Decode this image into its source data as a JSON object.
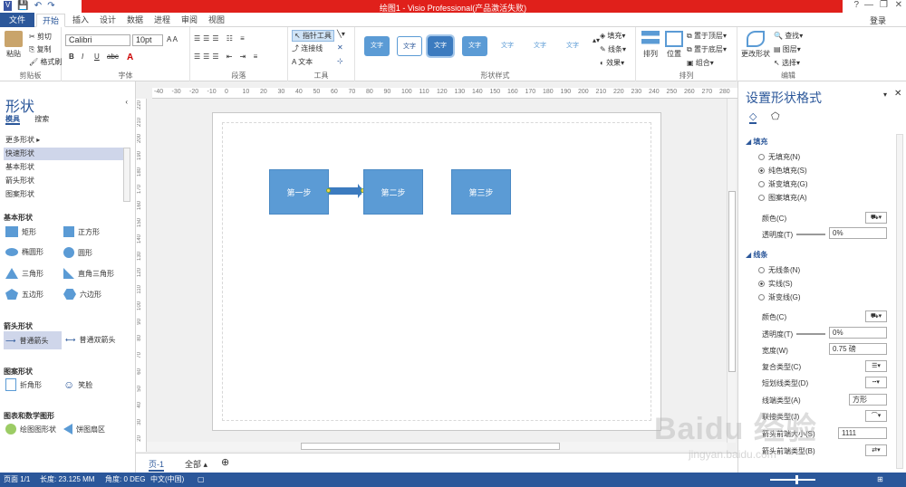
{
  "titlebar": {
    "title": "绘图1 - Visio Professional(产品激活失败)"
  },
  "menu": {
    "file": "文件",
    "tabs": [
      "开始",
      "插入",
      "设计",
      "数据",
      "进程",
      "审阅",
      "视图"
    ],
    "login": "登录"
  },
  "ribbon": {
    "clipboard": {
      "paste": "粘贴",
      "cut": "剪切",
      "copy": "复制",
      "format_painter": "格式刷",
      "label": "剪贴板"
    },
    "font": {
      "name": "Calibri",
      "size": "10pt",
      "bold": "B",
      "italic": "I",
      "underline": "U",
      "strike": "abc",
      "fontcolor": "A",
      "label": "字体"
    },
    "paragraph": {
      "label": "段落"
    },
    "tools": {
      "pointer": "指针工具",
      "connector": "连接线",
      "text": "文本",
      "label": "工具"
    },
    "shape_styles": {
      "previews": [
        "文字",
        "文字",
        "文字",
        "文字",
        "文字",
        "文字",
        "文字"
      ],
      "label": "形状样式",
      "fill": "填充",
      "line": "线条",
      "effects": "效果"
    },
    "arrange": {
      "align": "排列",
      "position": "位置",
      "bring_front": "置于顶层",
      "send_back": "置于底层",
      "group": "组合",
      "label": "排列"
    },
    "editing": {
      "change_shape": "更改形状",
      "find": "查找",
      "layers": "图层",
      "select": "选择",
      "label": "编辑"
    }
  },
  "shapes_panel": {
    "title": "形状",
    "tabs": [
      "模具",
      "搜索"
    ],
    "more": "更多形状",
    "stencils": [
      "快速形状",
      "基本形状",
      "箭头形状",
      "图案形状"
    ],
    "basic_title": "基本形状",
    "basic": [
      "矩形",
      "正方形",
      "椭圆形",
      "圆形",
      "三角形",
      "直角三角形",
      "五边形",
      "六边形"
    ],
    "arrow_title": "箭头形状",
    "arrows": [
      "普通箭头",
      "普通双箭头"
    ],
    "pattern_title": "图案形状",
    "patterns": [
      "折角形",
      "笑脸"
    ],
    "chart_title": "图表和数学图形",
    "charts": [
      "绘图图形状",
      "饼图扇区"
    ]
  },
  "ruler": {
    "h": [
      "-40",
      "-30",
      "-20",
      "-10",
      "0",
      "10",
      "20",
      "30",
      "40",
      "50",
      "60",
      "70",
      "80",
      "90",
      "100",
      "110",
      "120",
      "130",
      "140",
      "150",
      "160",
      "170",
      "180",
      "190",
      "200",
      "210",
      "220",
      "230",
      "240",
      "250",
      "260",
      "270",
      "280"
    ],
    "v": [
      "220",
      "210",
      "200",
      "190",
      "180",
      "170",
      "160",
      "150",
      "140",
      "130",
      "120",
      "110",
      "100",
      "90",
      "80",
      "70",
      "60",
      "50",
      "40",
      "30",
      "20"
    ]
  },
  "diagram": {
    "boxes": [
      "第一步",
      "第二步",
      "第三步"
    ]
  },
  "bottom": {
    "page": "页-1",
    "all": "全部"
  },
  "format_panel": {
    "title": "设置形状格式",
    "fill_title": "填充",
    "fill_opts": [
      "无填充(N)",
      "纯色填充(S)",
      "渐变填充(G)",
      "图案填充(A)"
    ],
    "fill_color": "颜色(C)",
    "fill_trans": "透明度(T)",
    "fill_trans_val": "0%",
    "line_title": "线条",
    "line_opts": [
      "无线条(N)",
      "实线(S)",
      "渐变线(G)"
    ],
    "line_color": "颜色(C)",
    "line_trans": "透明度(T)",
    "line_trans_val": "0%",
    "width": "宽度(W)",
    "width_val": "0.75 磅",
    "compound": "复合类型(C)",
    "dash": "短划线类型(D)",
    "cap": "线端类型(A)",
    "cap_val": "方形",
    "join": "联接类型(J)",
    "arrow_size": "箭头前端大小(S)",
    "arrow_size_val": "1111",
    "arrow_type": "箭头前端类型(B)"
  },
  "status": {
    "page": "页面 1/1",
    "length": "长度: 23.125 MM",
    "angle": "角度: 0 DEG",
    "lang": "中文(中国)"
  },
  "watermark": {
    "main": "Baidu 经验",
    "url": "jingyan.baidu.com"
  }
}
